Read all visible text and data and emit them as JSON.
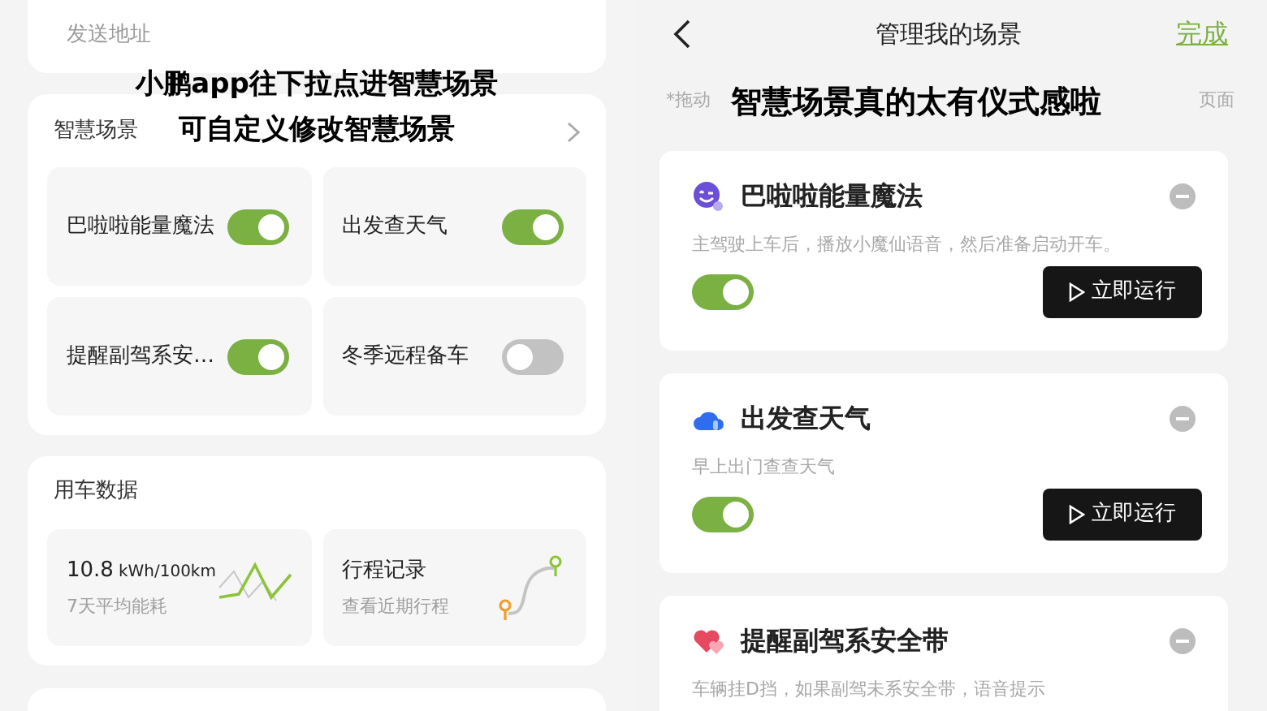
{
  "left": {
    "address_label": "发送地址",
    "scenes": {
      "title": "智慧场景",
      "tiles": [
        {
          "label": "巴啦啦能量魔法",
          "on": true
        },
        {
          "label": "出发查天气",
          "on": true
        },
        {
          "label": "提醒副驾系安…",
          "on": true
        },
        {
          "label": "冬季远程备车",
          "on": false
        }
      ]
    },
    "car_data": {
      "title": "用车数据",
      "energy": {
        "value": "10.8",
        "unit": "kWh/100km",
        "caption": "7天平均能耗"
      },
      "trips": {
        "title": "行程记录",
        "caption": "查看近期行程"
      }
    },
    "captions": [
      "小鹏app往下拉点进智慧场景",
      "可自定义修改智慧场景"
    ]
  },
  "right": {
    "title": "管理我的场景",
    "done": "完成",
    "hint_start": "*拖动",
    "hint_end": "页面",
    "caption": "智慧场景真的太有仪式感啦",
    "scenes": [
      {
        "kind": "magic",
        "name": "巴啦啦能量魔法",
        "description": "主驾驶上车后，播放小魔仙语音，然后准备启动开车。",
        "on": true,
        "run": "立即运行"
      },
      {
        "kind": "weather",
        "name": "出发查天气",
        "description": "早上出门查查天气",
        "on": true,
        "run": "立即运行"
      },
      {
        "kind": "heart",
        "name": "提醒副驾系安全带",
        "description": "车辆挂D挡，如果副驾未系安全带，语音提示"
      }
    ]
  }
}
